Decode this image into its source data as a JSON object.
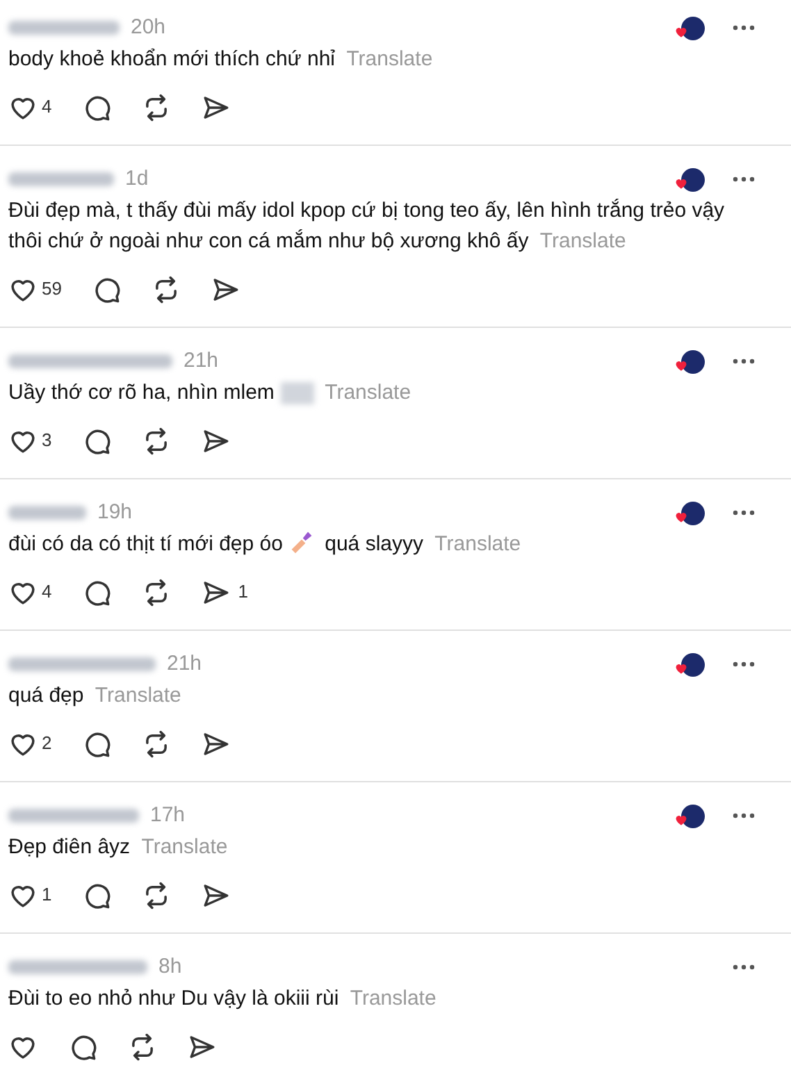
{
  "comments": [
    {
      "time": "20h",
      "body": [
        {
          "kind": "text",
          "text": "body khoẻ khoẩn mới thích chứ nhỉ"
        }
      ],
      "translate": "Translate",
      "liked_by_author": true,
      "likes": "4"
    },
    {
      "time": "1d",
      "body": [
        {
          "kind": "text",
          "text": "Đùi đẹp mà, t thấy đùi mấy idol kpop cứ bị tong teo ấy, lên hình trắng trẻo vậy"
        },
        {
          "kind": "text",
          "text": "thôi chứ ở ngoài như con cá mắm như bộ xương khô ấy"
        }
      ],
      "translate": "Translate",
      "liked_by_author": true,
      "likes": "59"
    },
    {
      "time": "21h",
      "body": [
        {
          "kind": "text",
          "text": "Uầy thớ cơ rõ ha, nhìn mlem"
        },
        {
          "kind": "blur"
        }
      ],
      "translate": "Translate",
      "liked_by_author": true,
      "likes": "3"
    },
    {
      "time": "19h",
      "body": [
        {
          "kind": "text",
          "text": "đùi có da có thịt tí mới đẹp óo"
        },
        {
          "kind": "emoji"
        },
        {
          "kind": "text",
          "text": "quá slayyy"
        }
      ],
      "translate": "Translate",
      "liked_by_author": true,
      "likes": "4",
      "shares": "1"
    },
    {
      "time": "21h",
      "body": [
        {
          "kind": "text",
          "text": "quá đẹp"
        }
      ],
      "translate": "Translate",
      "liked_by_author": true,
      "likes": "2"
    },
    {
      "time": "17h",
      "body": [
        {
          "kind": "text",
          "text": "Đẹp điên âyz"
        }
      ],
      "translate": "Translate",
      "liked_by_author": true,
      "likes": "1"
    },
    {
      "time": "8h",
      "body": [
        {
          "kind": "text",
          "text": "Đùi to eo nhỏ như Du vậy là okiii rùi"
        }
      ],
      "translate": "Translate",
      "liked_by_author": false
    }
  ]
}
